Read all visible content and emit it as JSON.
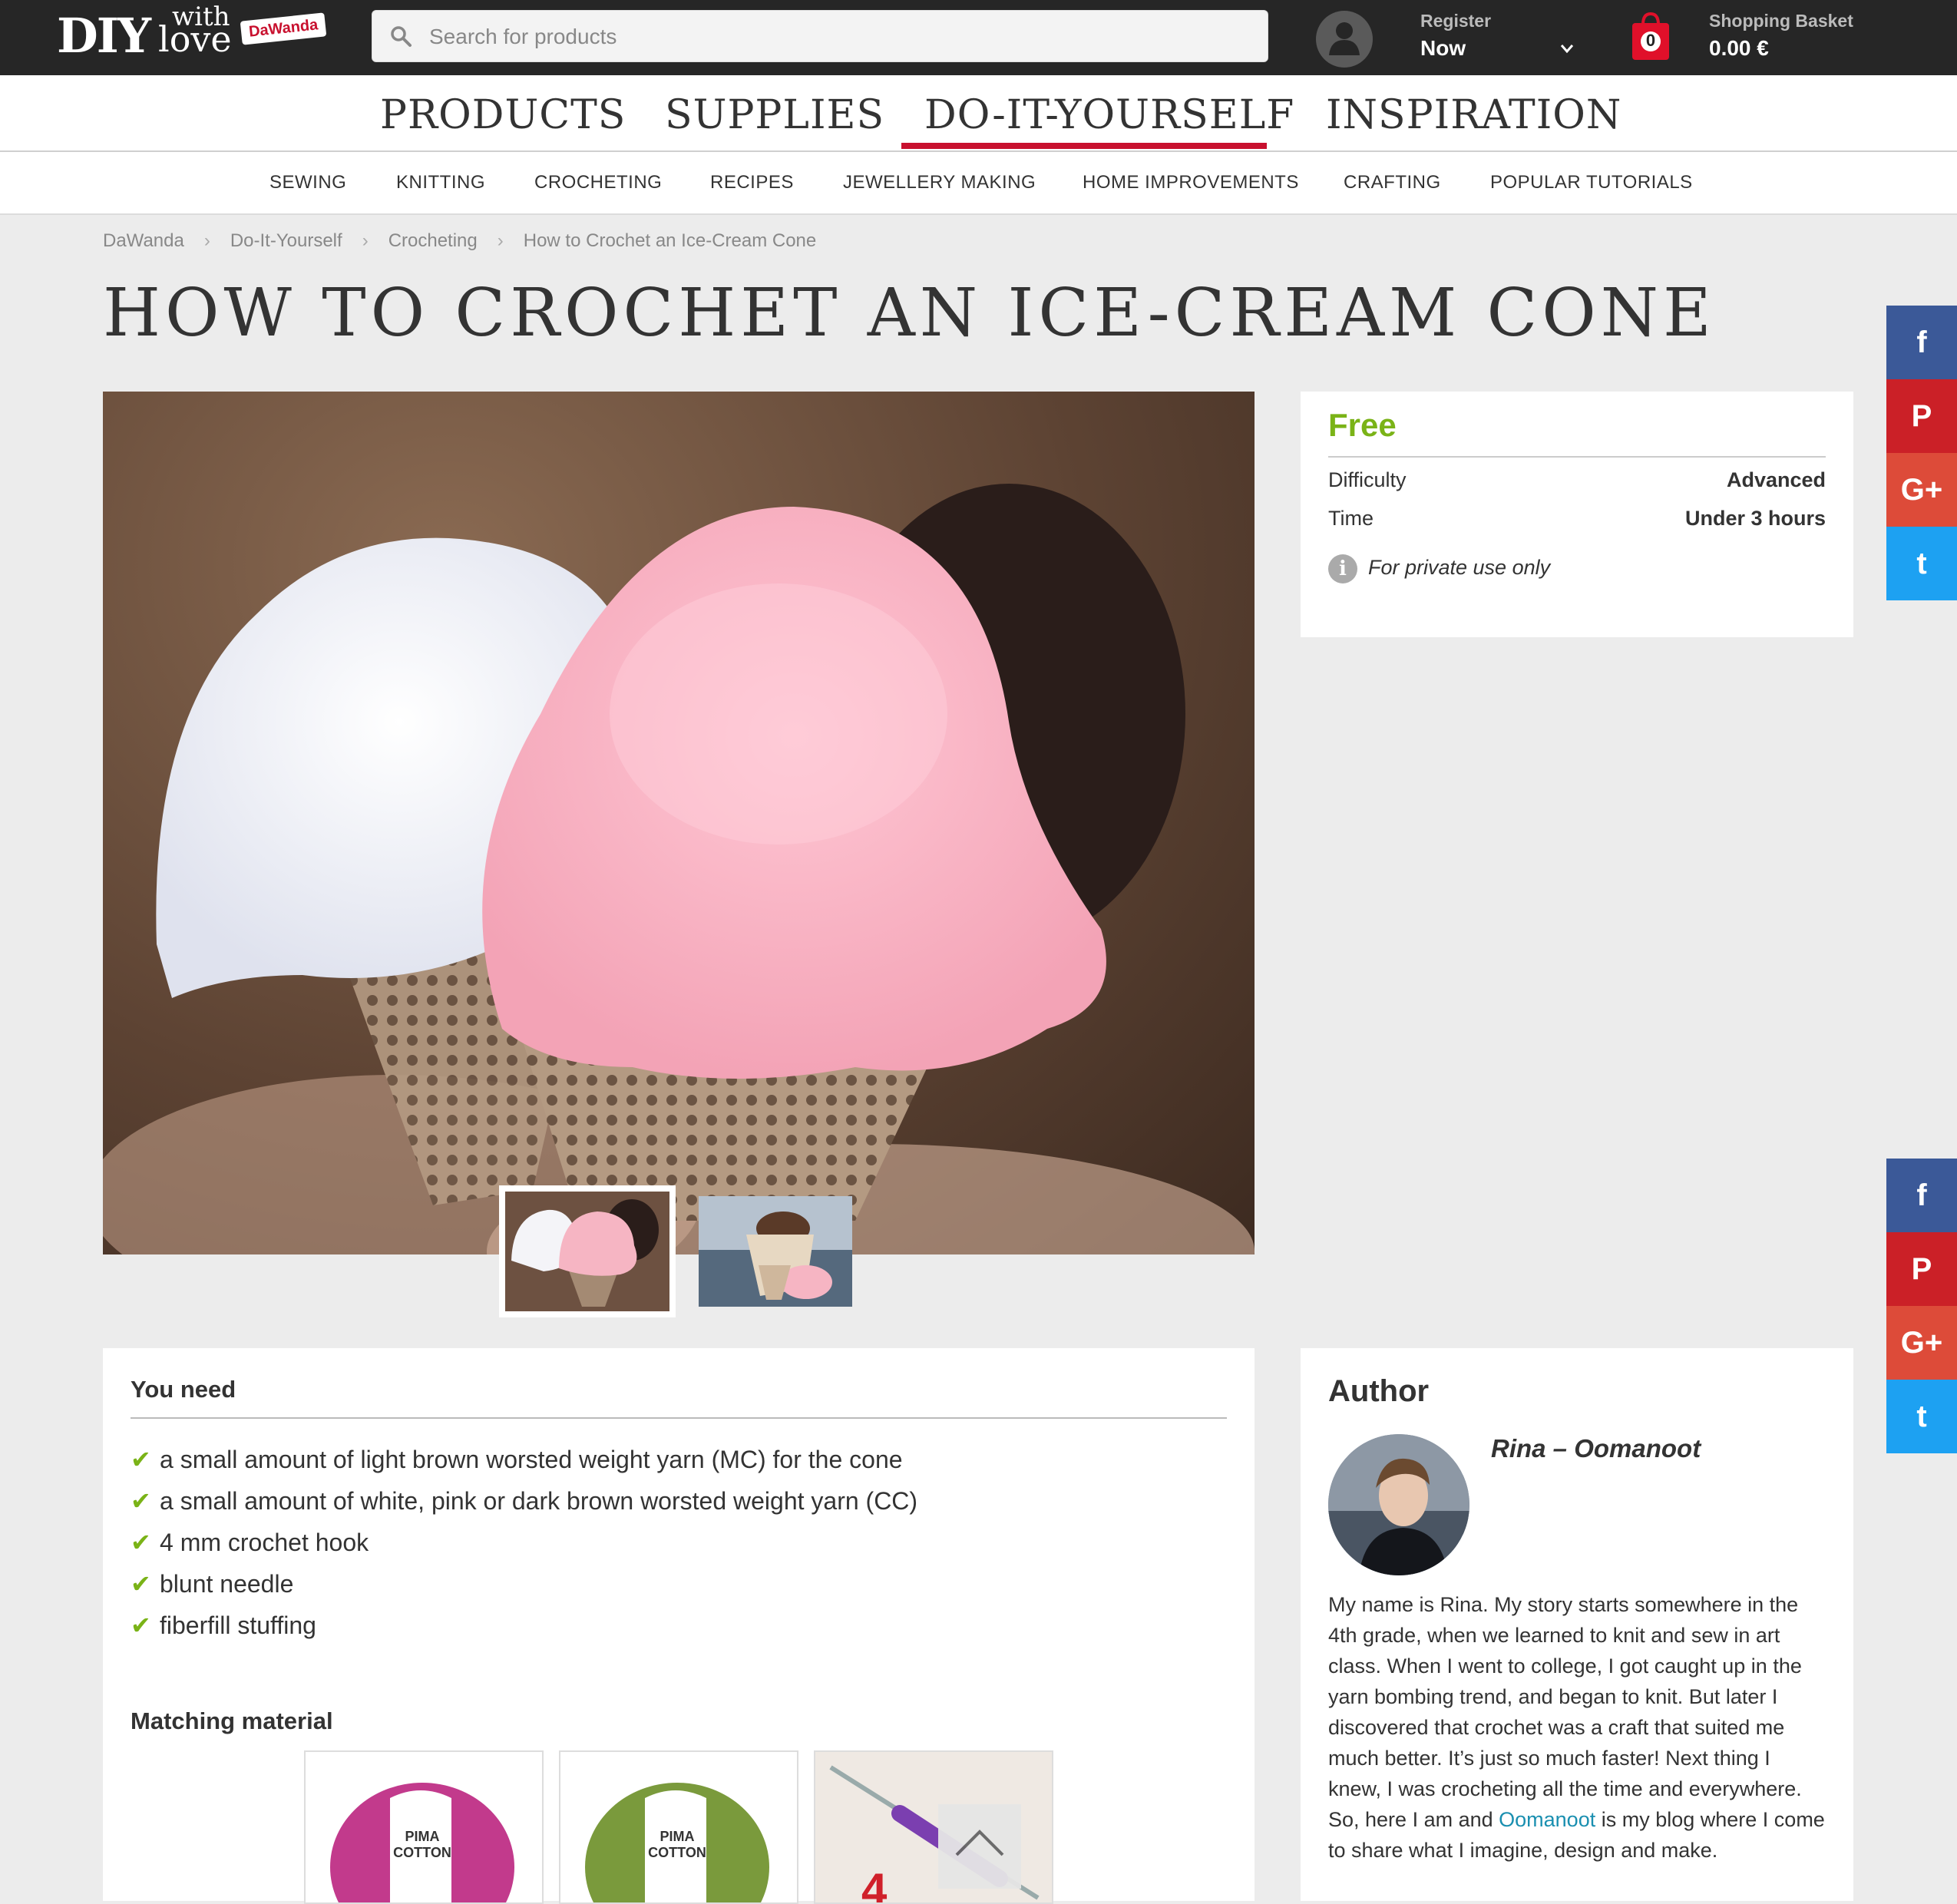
{
  "header": {
    "logo_main": "DIY",
    "logo_with": "with",
    "logo_love": "love",
    "logo_tag": "DaWanda",
    "search_placeholder": "Search for products",
    "register_small": "Register",
    "register_big": "Now",
    "basket_count": "0",
    "basket_small": "Shopping Basket",
    "basket_big": "0.00 €"
  },
  "main_nav": [
    "PRODUCTS",
    "SUPPLIES",
    "DO-IT-YOURSELF",
    "INSPIRATION"
  ],
  "sub_nav": [
    "SEWING",
    "KNITTING",
    "CROCHETING",
    "RECIPES",
    "JEWELLERY MAKING",
    "HOME IMPROVEMENTS",
    "CRAFTING",
    "POPULAR TUTORIALS"
  ],
  "breadcrumb": [
    "DaWanda",
    "Do-It-Yourself",
    "Crocheting",
    "How to Crochet an Ice-Cream Cone"
  ],
  "page_title": "HOW TO CROCHET AN ICE-CREAM CONE",
  "info": {
    "price": "Free",
    "difficulty_label": "Difficulty",
    "difficulty_value": "Advanced",
    "time_label": "Time",
    "time_value": "Under 3 hours",
    "usage_note": "For private use only"
  },
  "you_need": {
    "heading": "You need",
    "items": [
      "a small amount of light brown worsted weight yarn (MC) for the cone",
      "a small amount of white, pink or dark brown worsted weight yarn (CC)",
      "4 mm crochet hook",
      "blunt needle",
      "fiberfill stuffing"
    ],
    "matching_heading": "Matching material",
    "materials": [
      {
        "label": "PIMA COTTON",
        "color": "#c23a8c"
      },
      {
        "label": "PIMA COTTON",
        "color": "#7a9a3c"
      },
      {
        "label": "crochet hook",
        "color": "#7b3fb0"
      }
    ]
  },
  "author": {
    "heading": "Author",
    "name": "Rina – Oomanoot",
    "bio_before": "My name is Rina. My story starts somewhere in the 4th grade, when we learned to knit and sew in art class. When I went to college, I got caught up in the yarn bombing trend, and began to knit. But later I discovered that crochet was a craft that suited me much better. It’s just so much faster! Next thing I knew, I was crocheting all the time and everywhere. So, here I am and ",
    "bio_link": "Oomanoot",
    "bio_after": " is my blog where I come to share what I imagine, design and make."
  },
  "social": [
    "f",
    "P",
    "G+",
    "t"
  ],
  "colors": {
    "accent": "#c8102e",
    "price_green": "#7ab317",
    "link": "#1a8fb0",
    "facebook": "#3b5998",
    "pinterest": "#cb2027",
    "googleplus": "#dd4b39",
    "twitter": "#1da1f2"
  },
  "icons": [
    "search-icon",
    "user-icon",
    "chevron-down-icon",
    "basket-icon",
    "info-icon",
    "check-icon",
    "facebook-icon",
    "pinterest-icon",
    "googleplus-icon",
    "twitter-icon",
    "arrow-up-icon"
  ]
}
